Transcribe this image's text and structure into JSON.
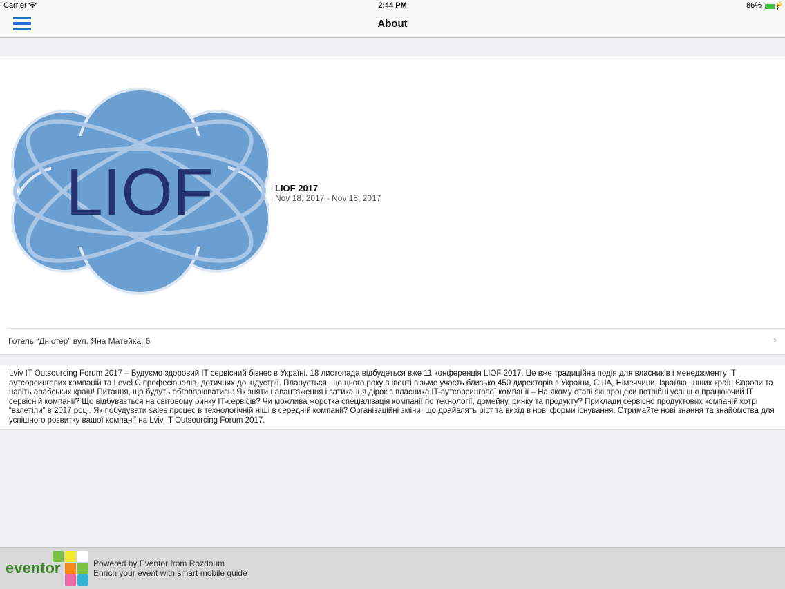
{
  "status_bar": {
    "carrier": "Carrier",
    "time": "2:44 PM",
    "battery": "86%"
  },
  "nav": {
    "title": "About"
  },
  "logo": {
    "text": "LIOF"
  },
  "event": {
    "name": "LIOF 2017",
    "dates": "Nov 18, 2017 - Nov 18, 2017"
  },
  "address": "Готель “Дністер” вул. Яна Матейка, 6",
  "description": "Lviv IT Outsourcing Forum 2017 – Будуємо здоровий IT сервісний бізнес в Україні. 18 листопада відбудеться вже 11 конференція LIOF 2017. Це вже традиційна подія для власників і менеджменту IT аутсорсингових компаній та Level C професіоналів, дотичних до індустрії. Планується, що цього року в івенті візьме участь близько 450 директорів з України, США, Німеччини, Ізраїлю, інших країн Європи та навіть арабських країн! Питання, що будуть обговорюватись: Як зняти навантаження і затикання дірок з власника IT-аутсорсингової компанії – На якому етапі які процеси потрібні успішно працюючий IT сервісній компанії? Що відбувається на світовому ринку IT-сервісів? Чи можлива жорстка спеціалізація компанії по технології, домейну, ринку та продукту? Приклади сервісно продуктових компаній котрі “взлетіли” в 2017 році. Як побудувати sales процес в технологічній ніші в середній компанії? Організаційні зміни, що драйвлять ріст та вихід в нові форми існування. Отримайте нові знання та знайомства для успішного розвитку вашої компанії на Lviv IT Outsourcing Forum 2017.",
  "footer": {
    "brand": "eventor",
    "line1": "Powered by Eventor from Rozdoum",
    "line2": "Enrich your event with smart mobile guide"
  },
  "colors": {
    "accent": "#1f6fd1",
    "logo_blue": "#6b9fd2",
    "logo_text": "#23326e",
    "battery": "#39c439"
  }
}
